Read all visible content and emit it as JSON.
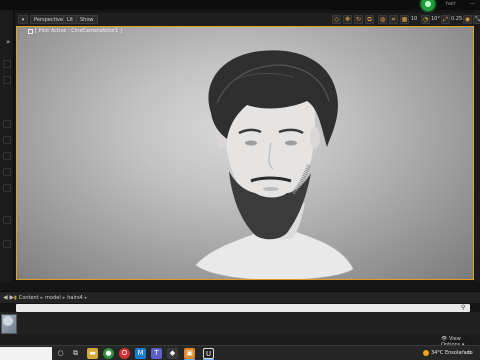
{
  "window": {
    "title": "hair",
    "status_color": "#1f9d3a"
  },
  "viewport_toolbar": {
    "perspective_label": "Perspective",
    "lit_label": "Lit",
    "show_label": "Show",
    "grid_value": "10",
    "rot_value": "10°",
    "scale_value": "0.25",
    "cam_speed": "4",
    "accent_color": "#e0a019"
  },
  "viewport": {
    "pilot_label": "[ Pilot Active - CineCameraActor1 ]"
  },
  "content_browser": {
    "breadcrumb": [
      "Content",
      "model",
      "hairs4"
    ],
    "view_options_label": "View Options"
  },
  "taskbar": {
    "weather_text": "34°C Ensolarado",
    "apps": [
      "search",
      "task-view",
      "file-explorer",
      "chrome",
      "opera",
      "sticky",
      "teams",
      "unreal-project",
      "vscode",
      "unreal-engine"
    ]
  }
}
